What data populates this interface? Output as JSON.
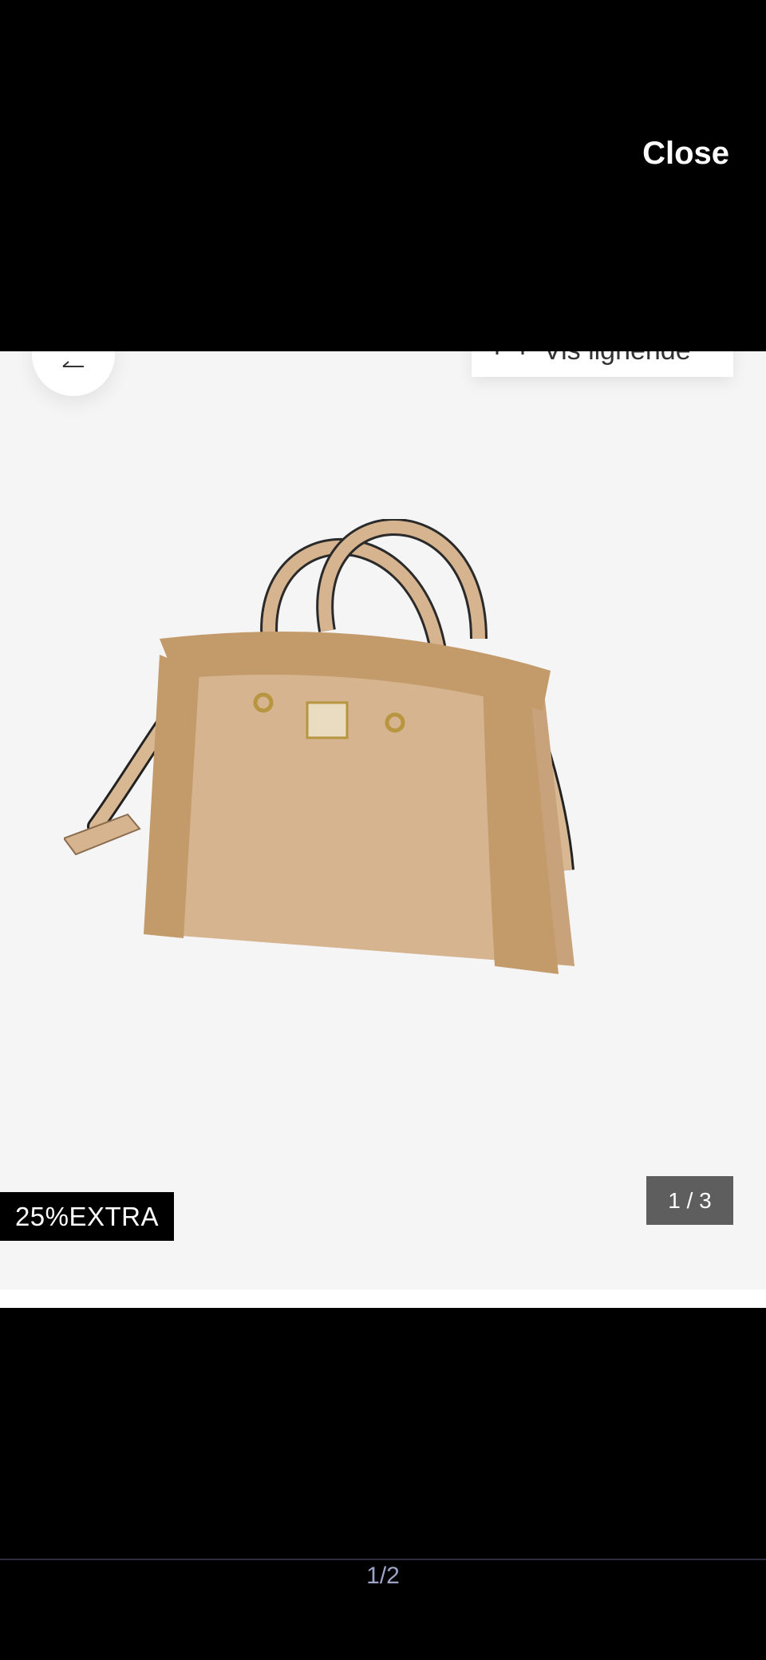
{
  "modal": {
    "close_label": "Close",
    "pager": "1/2"
  },
  "viewer": {
    "similar_label": "Vis lignende",
    "promo_badge": "25%EXTRA",
    "image_counter": "1 / 3",
    "image_alt": "Beige faux-fur trimmed handbag with ring handles"
  },
  "colors": {
    "background": "#000000",
    "viewer_bg": "#f5f5f5",
    "bag_leather": "#d6b48f",
    "bag_fur": "#c39a6a",
    "counter_bg": "#5e5e5e",
    "pager_text": "#9da3c7"
  }
}
